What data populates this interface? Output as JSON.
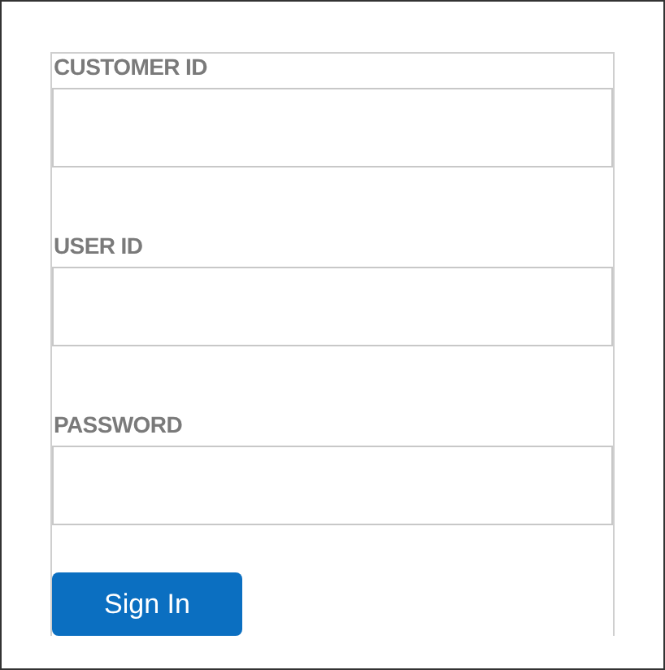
{
  "fields": [
    {
      "label": "CUSTOMER ID"
    },
    {
      "label": "USER ID"
    },
    {
      "label": "PASSWORD"
    }
  ],
  "button": "Sign In"
}
